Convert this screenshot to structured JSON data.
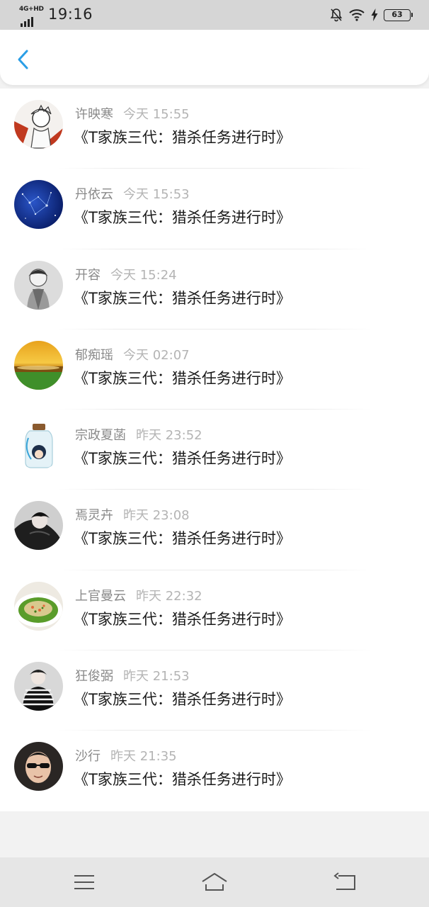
{
  "status_bar": {
    "network": "4G+HD",
    "time": "19:16",
    "battery": "63",
    "icons": [
      "signal-icon",
      "bell-off-icon",
      "wifi-icon",
      "charging-icon",
      "battery-icon"
    ]
  },
  "header": {
    "back_icon": "chevron-left-icon",
    "accent_color": "#2a9ee6"
  },
  "comments": [
    {
      "name": "许映寒",
      "time": "今天 15:55",
      "content": "《T家族三代：猎杀任务进行时》"
    },
    {
      "name": "丹依云",
      "time": "今天 15:53",
      "content": "《T家族三代：猎杀任务进行时》"
    },
    {
      "name": "开容",
      "time": "今天 15:24",
      "content": "《T家族三代：猎杀任务进行时》"
    },
    {
      "name": "郁痴瑶",
      "time": "今天 02:07",
      "content": "《T家族三代：猎杀任务进行时》"
    },
    {
      "name": "宗政夏菡",
      "time": "昨天 23:52",
      "content": "《T家族三代：猎杀任务进行时》"
    },
    {
      "name": "焉灵卉",
      "time": "昨天 23:08",
      "content": "《T家族三代：猎杀任务进行时》"
    },
    {
      "name": "上官曼云",
      "time": "昨天 22:32",
      "content": "《T家族三代：猎杀任务进行时》"
    },
    {
      "name": "狂俊弼",
      "time": "昨天 21:53",
      "content": "《T家族三代：猎杀任务进行时》"
    },
    {
      "name": "沙行",
      "time": "昨天 21:35",
      "content": "《T家族三代：猎杀任务进行时》"
    }
  ],
  "nav_bar": {
    "icons": [
      "menu-icon",
      "home-icon",
      "back-icon"
    ]
  }
}
